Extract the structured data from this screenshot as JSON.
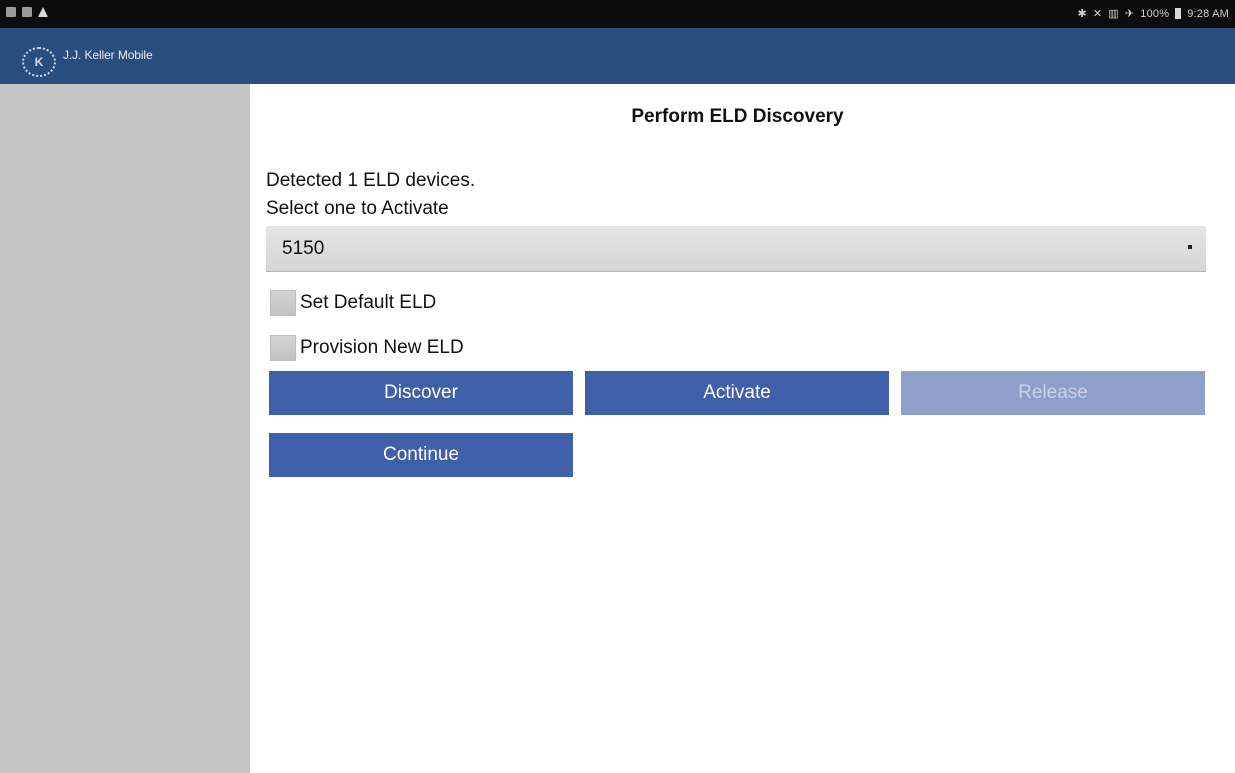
{
  "status_bar": {
    "left_icons": [
      "gallery-icon",
      "sim-icon",
      "alert-icon"
    ],
    "right_text": "100%",
    "time": "9:28 AM",
    "right_icons": [
      "bluetooth-icon",
      "mute-icon",
      "signal-icon",
      "airplane-icon",
      "battery-icon"
    ]
  },
  "app_bar": {
    "title": "J.J. Keller Mobile",
    "logo": "jj-keller-logo-icon",
    "background": "#2a4d80"
  },
  "main": {
    "page_title": "Perform ELD Discovery",
    "detected_text": "Detected 1 ELD devices.",
    "select_prompt": "Select one to Activate",
    "device_select": {
      "value": "5150"
    },
    "checkboxes": [
      {
        "label": "Set Default ELD",
        "checked": false
      },
      {
        "label": "Provision New ELD",
        "checked": false
      }
    ],
    "buttons": {
      "discover": "Discover",
      "activate": "Activate",
      "release": "Release",
      "continue": "Continue"
    }
  },
  "colors": {
    "button_primary": "#3f5fa9",
    "button_disabled": "#8e9fc9",
    "sidebar": "#c4c4c4"
  }
}
